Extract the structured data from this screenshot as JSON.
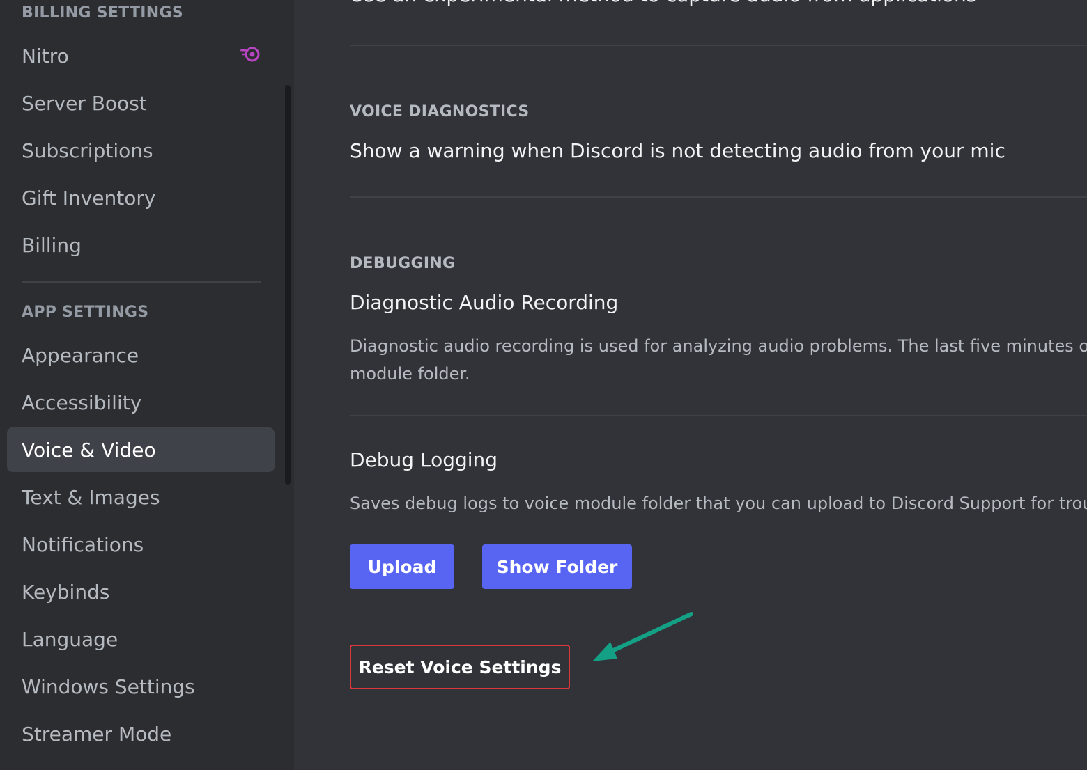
{
  "sidebar": {
    "billing_header": "BILLING SETTINGS",
    "billing_items": [
      {
        "label": "Nitro"
      },
      {
        "label": "Server Boost"
      },
      {
        "label": "Subscriptions"
      },
      {
        "label": "Gift Inventory"
      },
      {
        "label": "Billing"
      }
    ],
    "app_header": "APP SETTINGS",
    "app_items": [
      {
        "label": "Appearance"
      },
      {
        "label": "Accessibility"
      },
      {
        "label": "Voice & Video",
        "active": true
      },
      {
        "label": "Text & Images"
      },
      {
        "label": "Notifications"
      },
      {
        "label": "Keybinds"
      },
      {
        "label": "Language"
      },
      {
        "label": "Windows Settings"
      },
      {
        "label": "Streamer Mode"
      }
    ],
    "nitro_icon": "nitro-icon"
  },
  "main": {
    "top_text": "Use an experimental method to capture audio from applications",
    "voice_diagnostics": {
      "header": "VOICE DIAGNOSTICS",
      "title": "Show a warning when Discord is not detecting audio from your mic"
    },
    "debugging": {
      "header": "DEBUGGING",
      "recording_title": "Diagnostic Audio Recording",
      "recording_desc_line1": "Diagnostic audio recording is used for analyzing audio problems. The last five minutes of v",
      "recording_desc_line2": "module folder.",
      "logging_title": "Debug Logging",
      "logging_desc": "Saves debug logs to voice module folder that you can upload to Discord Support for troub"
    },
    "buttons": {
      "upload": "Upload",
      "show_folder": "Show Folder",
      "reset": "Reset Voice Settings"
    }
  },
  "colors": {
    "accent": "#5865f2",
    "danger": "#da373c",
    "annotation_arrow": "#14a085",
    "nitro": "#b845c1"
  }
}
